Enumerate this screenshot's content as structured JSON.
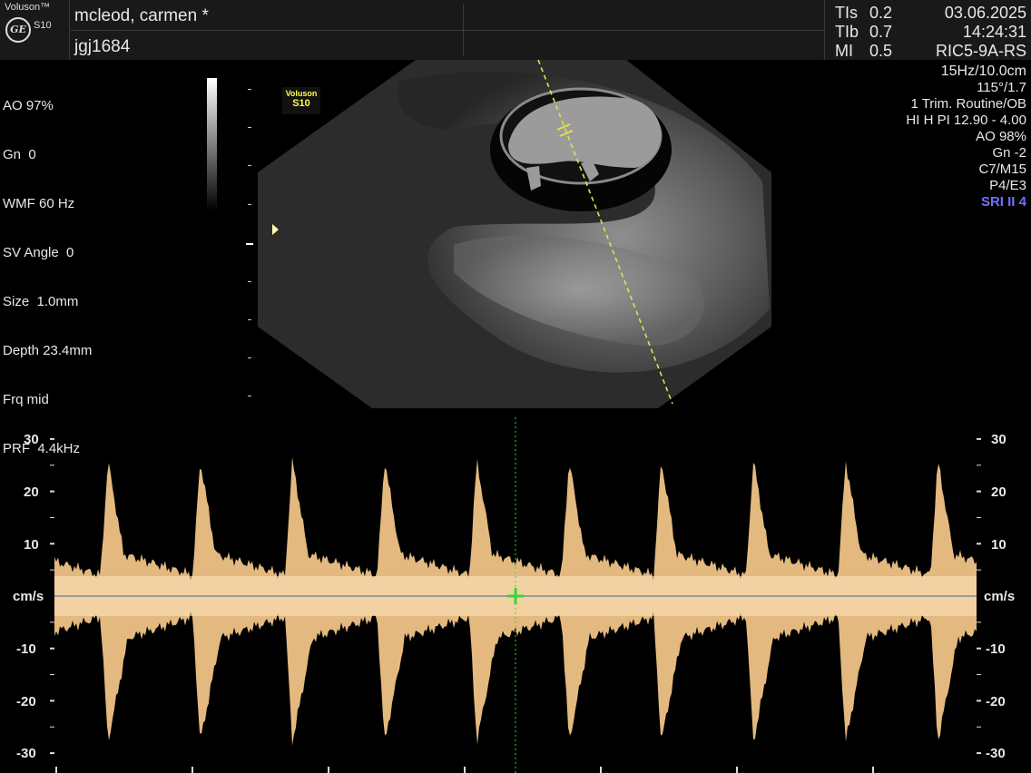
{
  "header": {
    "brand": "Voluson™",
    "brand_logo": "GE",
    "model": "S10",
    "patient_name": "mcleod, carmen  *",
    "patient_id": "jgj1684",
    "indices": [
      {
        "label": "TIs",
        "value": "0.2"
      },
      {
        "label": "TIb",
        "value": "0.7"
      },
      {
        "label": "MI",
        "value": "0.5"
      }
    ],
    "date": "03.06.2025",
    "time": "14:24:31",
    "probe": "RIC5-9A-RS"
  },
  "left_params": [
    "AO 97%",
    "Gn  0",
    "WMF 60 Hz",
    "SV Angle  0",
    "Size  1.0mm",
    "Depth 23.4mm",
    "Frq mid",
    "PRF  4.4kHz"
  ],
  "right_params": [
    "15Hz/10.0cm",
    "115°/1.7",
    "1 Trim. Routine/OB",
    "HI H PI 12.90 - 4.00",
    "AO 98%",
    "Gn  -2",
    "C7/M15",
    "P4/E3"
  ],
  "sri_label": "SRI II 4",
  "badge": {
    "line1": "Voluson",
    "line2": "S10"
  },
  "doppler": {
    "unit": "cm/s",
    "ticks": [
      "30",
      "20",
      "10",
      "-10",
      "-20",
      "-30"
    ],
    "scale_max_cms": 30,
    "scale_min_cms": -30,
    "cycles": 10,
    "peak_velocity_cms": 26,
    "trough_velocity_cms": -28
  },
  "colors": {
    "spectrum": "#f6c98a",
    "cursor": "#39d639",
    "sample_line": "#e0e050",
    "sri": "#7070ff"
  }
}
